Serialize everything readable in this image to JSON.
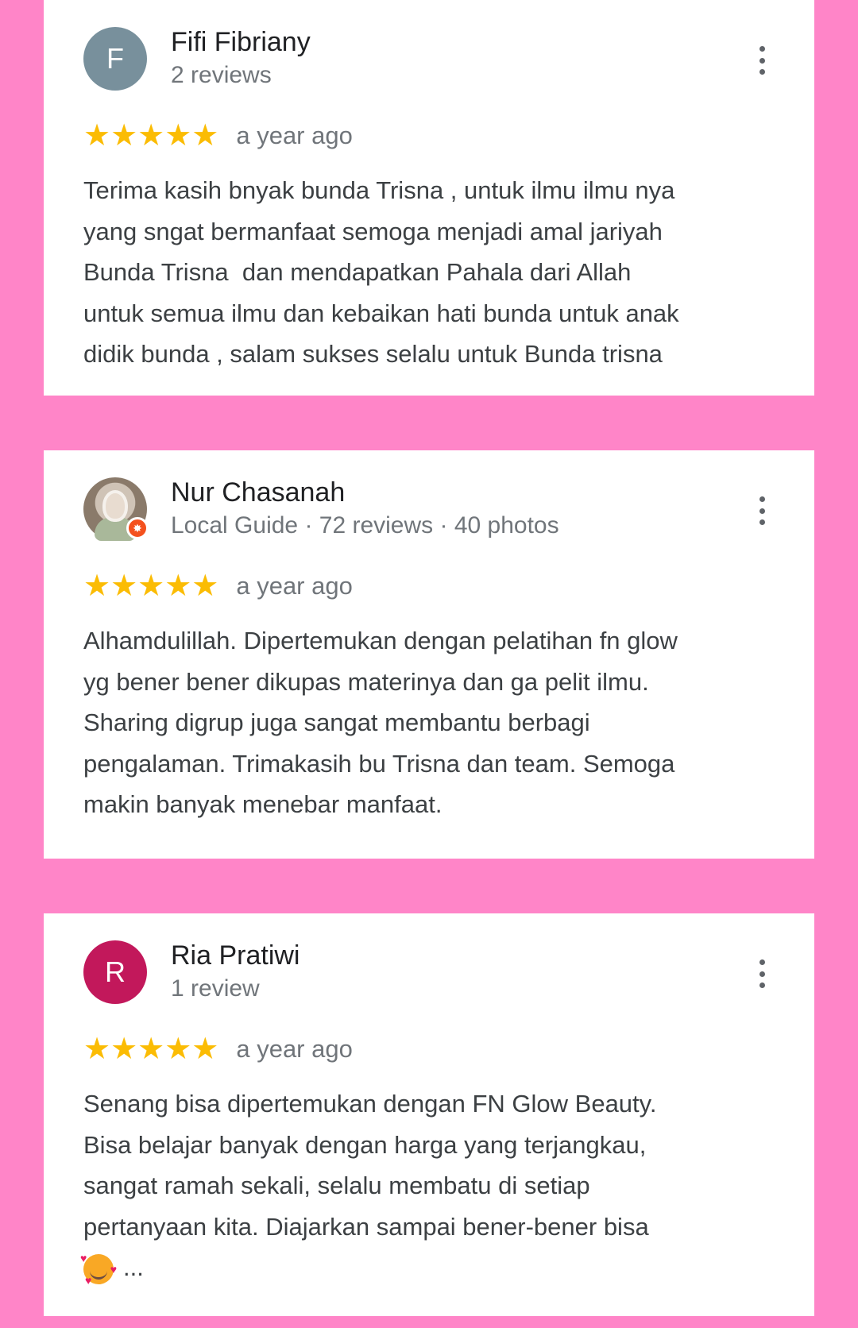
{
  "reviews": [
    {
      "initial": "F",
      "name": "Fifi Fibriany",
      "meta": "2 reviews",
      "stars": "★★★★★",
      "time": "a year ago",
      "text": "Terima kasih bnyak bunda Trisna , untuk ilmu ilmu nya\nyang sngat bermanfaat semoga menjadi amal jariyah\nBunda Trisna  dan mendapatkan Pahala dari Allah\nuntuk semua ilmu dan kebaikan hati bunda untuk anak\ndidik bunda , salam sukses selalu untuk Bunda trisna"
    },
    {
      "name": "Nur Chasanah",
      "meta": "Local Guide · 72 reviews · 40 photos",
      "stars": "★★★★★",
      "time": "a year ago",
      "text": "Alhamdulillah. Dipertemukan dengan pelatihan fn glow\nyg bener bener dikupas materinya dan ga pelit ilmu.\nSharing digrup juga sangat membantu berbagi\npengalaman. Trimakasih bu Trisna dan team. Semoga\nmakin banyak menebar manfaat."
    },
    {
      "initial": "R",
      "name": "Ria Pratiwi",
      "meta": "1 review",
      "stars": "★★★★★",
      "time": "a year ago",
      "text": "Senang bisa dipertemukan dengan FN Glow Beauty.\nBisa belajar banyak dengan harga yang terjangkau,\nsangat ramah sekali, selalu membatu di setiap\npertanyaan kita. Diajarkan sampai bener-bener bisa\n",
      "ellipsis": "..."
    }
  ],
  "colors": {
    "background": "#ff85c8",
    "star": "#fbbc04",
    "avatar_gray": "#78909c",
    "avatar_magenta": "#c2185b",
    "local_guide_badge": "#f4511e"
  },
  "icons": {
    "more": "more-vert-icon",
    "star": "star-icon",
    "local_guide": "local-guide-badge-icon",
    "emoji": "smiling-face-with-hearts-emoji"
  }
}
